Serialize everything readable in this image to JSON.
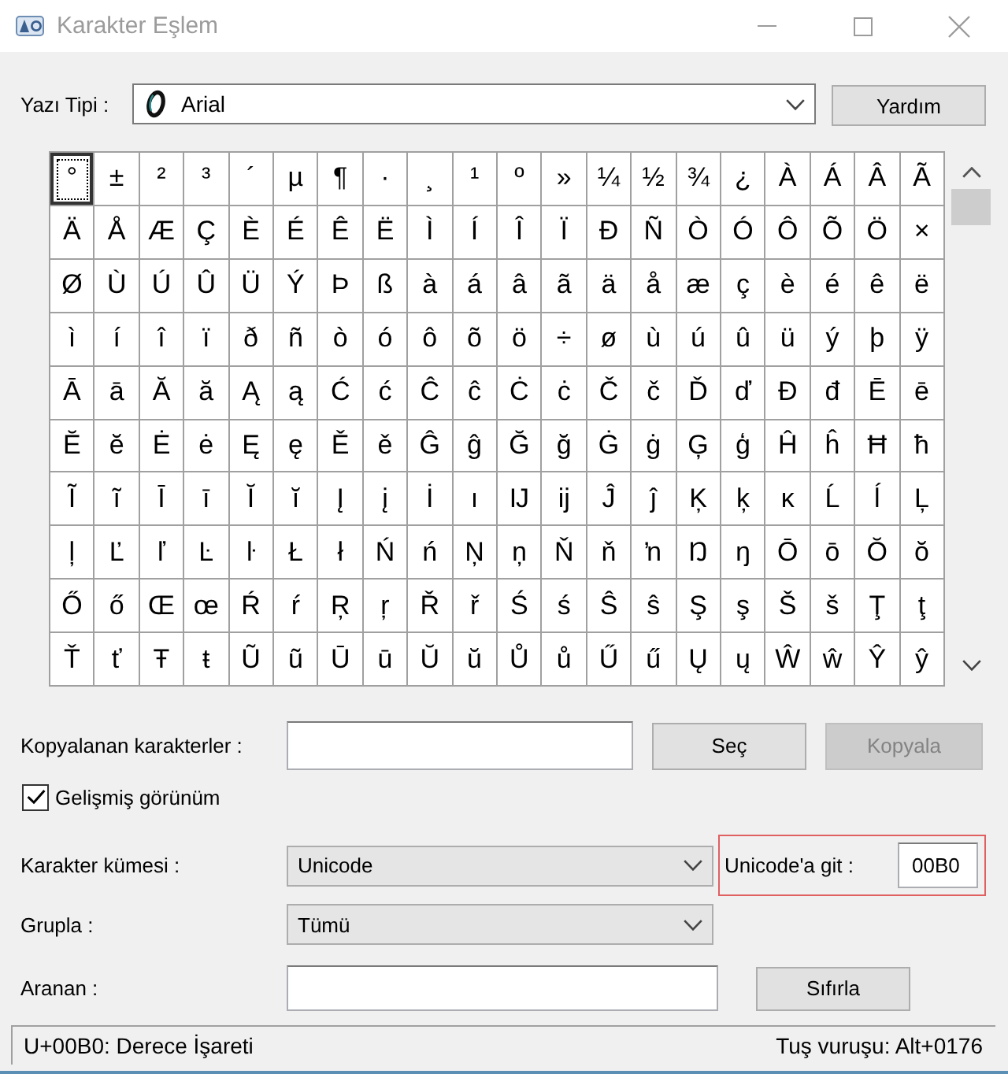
{
  "window": {
    "title": "Karakter Eşlem"
  },
  "font_row": {
    "label": "Yazı Tipi :",
    "font": "Arial",
    "help_button": "Yardım"
  },
  "character_grid": {
    "rows": [
      [
        {
          "char": "°",
          "selected": true
        },
        {
          "char": "±",
          "selected": false
        },
        {
          "char": "²",
          "selected": false
        },
        {
          "char": "³",
          "selected": false
        },
        {
          "char": "´",
          "selected": false
        },
        {
          "char": "µ",
          "selected": false
        },
        {
          "char": "¶",
          "selected": false
        },
        {
          "char": "·",
          "selected": false
        },
        {
          "char": "¸",
          "selected": false
        },
        {
          "char": "¹",
          "selected": false
        },
        {
          "char": "º",
          "selected": false
        },
        {
          "char": "»",
          "selected": false
        },
        {
          "char": "¼",
          "selected": false
        },
        {
          "char": "½",
          "selected": false
        },
        {
          "char": "¾",
          "selected": false
        },
        {
          "char": "¿",
          "selected": false
        },
        {
          "char": "À",
          "selected": false
        },
        {
          "char": "Á",
          "selected": false
        },
        {
          "char": "Â",
          "selected": false
        },
        {
          "char": "Ã",
          "selected": false
        }
      ],
      [
        {
          "char": "Ä",
          "selected": false
        },
        {
          "char": "Å",
          "selected": false
        },
        {
          "char": "Æ",
          "selected": false
        },
        {
          "char": "Ç",
          "selected": false
        },
        {
          "char": "È",
          "selected": false
        },
        {
          "char": "É",
          "selected": false
        },
        {
          "char": "Ê",
          "selected": false
        },
        {
          "char": "Ë",
          "selected": false
        },
        {
          "char": "Ì",
          "selected": false
        },
        {
          "char": "Í",
          "selected": false
        },
        {
          "char": "Î",
          "selected": false
        },
        {
          "char": "Ï",
          "selected": false
        },
        {
          "char": "Ð",
          "selected": false
        },
        {
          "char": "Ñ",
          "selected": false
        },
        {
          "char": "Ò",
          "selected": false
        },
        {
          "char": "Ó",
          "selected": false
        },
        {
          "char": "Ô",
          "selected": false
        },
        {
          "char": "Õ",
          "selected": false
        },
        {
          "char": "Ö",
          "selected": false
        },
        {
          "char": "×",
          "selected": false
        }
      ],
      [
        {
          "char": "Ø",
          "selected": false
        },
        {
          "char": "Ù",
          "selected": false
        },
        {
          "char": "Ú",
          "selected": false
        },
        {
          "char": "Û",
          "selected": false
        },
        {
          "char": "Ü",
          "selected": false
        },
        {
          "char": "Ý",
          "selected": false
        },
        {
          "char": "Þ",
          "selected": false
        },
        {
          "char": "ß",
          "selected": false
        },
        {
          "char": "à",
          "selected": false
        },
        {
          "char": "á",
          "selected": false
        },
        {
          "char": "â",
          "selected": false
        },
        {
          "char": "ã",
          "selected": false
        },
        {
          "char": "ä",
          "selected": false
        },
        {
          "char": "å",
          "selected": false
        },
        {
          "char": "æ",
          "selected": false
        },
        {
          "char": "ç",
          "selected": false
        },
        {
          "char": "è",
          "selected": false
        },
        {
          "char": "é",
          "selected": false
        },
        {
          "char": "ê",
          "selected": false
        },
        {
          "char": "ë",
          "selected": false
        }
      ],
      [
        {
          "char": "ì",
          "selected": false
        },
        {
          "char": "í",
          "selected": false
        },
        {
          "char": "î",
          "selected": false
        },
        {
          "char": "ï",
          "selected": false
        },
        {
          "char": "ð",
          "selected": false
        },
        {
          "char": "ñ",
          "selected": false
        },
        {
          "char": "ò",
          "selected": false
        },
        {
          "char": "ó",
          "selected": false
        },
        {
          "char": "ô",
          "selected": false
        },
        {
          "char": "õ",
          "selected": false
        },
        {
          "char": "ö",
          "selected": false
        },
        {
          "char": "÷",
          "selected": false
        },
        {
          "char": "ø",
          "selected": false
        },
        {
          "char": "ù",
          "selected": false
        },
        {
          "char": "ú",
          "selected": false
        },
        {
          "char": "û",
          "selected": false
        },
        {
          "char": "ü",
          "selected": false
        },
        {
          "char": "ý",
          "selected": false
        },
        {
          "char": "þ",
          "selected": false
        },
        {
          "char": "ÿ",
          "selected": false
        }
      ],
      [
        {
          "char": "Ā",
          "selected": false
        },
        {
          "char": "ā",
          "selected": false
        },
        {
          "char": "Ă",
          "selected": false
        },
        {
          "char": "ă",
          "selected": false
        },
        {
          "char": "Ą",
          "selected": false
        },
        {
          "char": "ą",
          "selected": false
        },
        {
          "char": "Ć",
          "selected": false
        },
        {
          "char": "ć",
          "selected": false
        },
        {
          "char": "Ĉ",
          "selected": false
        },
        {
          "char": "ĉ",
          "selected": false
        },
        {
          "char": "Ċ",
          "selected": false
        },
        {
          "char": "ċ",
          "selected": false
        },
        {
          "char": "Č",
          "selected": false
        },
        {
          "char": "č",
          "selected": false
        },
        {
          "char": "Ď",
          "selected": false
        },
        {
          "char": "ď",
          "selected": false
        },
        {
          "char": "Đ",
          "selected": false
        },
        {
          "char": "đ",
          "selected": false
        },
        {
          "char": "Ē",
          "selected": false
        },
        {
          "char": "ē",
          "selected": false
        }
      ],
      [
        {
          "char": "Ĕ",
          "selected": false
        },
        {
          "char": "ĕ",
          "selected": false
        },
        {
          "char": "Ė",
          "selected": false
        },
        {
          "char": "ė",
          "selected": false
        },
        {
          "char": "Ę",
          "selected": false
        },
        {
          "char": "ę",
          "selected": false
        },
        {
          "char": "Ě",
          "selected": false
        },
        {
          "char": "ě",
          "selected": false
        },
        {
          "char": "Ĝ",
          "selected": false
        },
        {
          "char": "ĝ",
          "selected": false
        },
        {
          "char": "Ğ",
          "selected": false
        },
        {
          "char": "ğ",
          "selected": false
        },
        {
          "char": "Ġ",
          "selected": false
        },
        {
          "char": "ġ",
          "selected": false
        },
        {
          "char": "Ģ",
          "selected": false
        },
        {
          "char": "ģ",
          "selected": false
        },
        {
          "char": "Ĥ",
          "selected": false
        },
        {
          "char": "ĥ",
          "selected": false
        },
        {
          "char": "Ħ",
          "selected": false
        },
        {
          "char": "ħ",
          "selected": false
        }
      ],
      [
        {
          "char": "Ĩ",
          "selected": false
        },
        {
          "char": "ĩ",
          "selected": false
        },
        {
          "char": "Ī",
          "selected": false
        },
        {
          "char": "ī",
          "selected": false
        },
        {
          "char": "Ĭ",
          "selected": false
        },
        {
          "char": "ĭ",
          "selected": false
        },
        {
          "char": "Į",
          "selected": false
        },
        {
          "char": "į",
          "selected": false
        },
        {
          "char": "İ",
          "selected": false
        },
        {
          "char": "ı",
          "selected": false
        },
        {
          "char": "Ĳ",
          "selected": false
        },
        {
          "char": "ĳ",
          "selected": false
        },
        {
          "char": "Ĵ",
          "selected": false
        },
        {
          "char": "ĵ",
          "selected": false
        },
        {
          "char": "Ķ",
          "selected": false
        },
        {
          "char": "ķ",
          "selected": false
        },
        {
          "char": "ĸ",
          "selected": false
        },
        {
          "char": "Ĺ",
          "selected": false
        },
        {
          "char": "ĺ",
          "selected": false
        },
        {
          "char": "Ļ",
          "selected": false
        }
      ],
      [
        {
          "char": "ļ",
          "selected": false
        },
        {
          "char": "Ľ",
          "selected": false
        },
        {
          "char": "ľ",
          "selected": false
        },
        {
          "char": "Ŀ",
          "selected": false
        },
        {
          "char": "ŀ",
          "selected": false
        },
        {
          "char": "Ł",
          "selected": false
        },
        {
          "char": "ł",
          "selected": false
        },
        {
          "char": "Ń",
          "selected": false
        },
        {
          "char": "ń",
          "selected": false
        },
        {
          "char": "Ņ",
          "selected": false
        },
        {
          "char": "ņ",
          "selected": false
        },
        {
          "char": "Ň",
          "selected": false
        },
        {
          "char": "ň",
          "selected": false
        },
        {
          "char": "ŉ",
          "selected": false
        },
        {
          "char": "Ŋ",
          "selected": false
        },
        {
          "char": "ŋ",
          "selected": false
        },
        {
          "char": "Ō",
          "selected": false
        },
        {
          "char": "ō",
          "selected": false
        },
        {
          "char": "Ŏ",
          "selected": false
        },
        {
          "char": "ŏ",
          "selected": false
        }
      ],
      [
        {
          "char": "Ő",
          "selected": false
        },
        {
          "char": "ő",
          "selected": false
        },
        {
          "char": "Œ",
          "selected": false
        },
        {
          "char": "œ",
          "selected": false
        },
        {
          "char": "Ŕ",
          "selected": false
        },
        {
          "char": "ŕ",
          "selected": false
        },
        {
          "char": "Ŗ",
          "selected": false
        },
        {
          "char": "ŗ",
          "selected": false
        },
        {
          "char": "Ř",
          "selected": false
        },
        {
          "char": "ř",
          "selected": false
        },
        {
          "char": "Ś",
          "selected": false
        },
        {
          "char": "ś",
          "selected": false
        },
        {
          "char": "Ŝ",
          "selected": false
        },
        {
          "char": "ŝ",
          "selected": false
        },
        {
          "char": "Ş",
          "selected": false
        },
        {
          "char": "ş",
          "selected": false
        },
        {
          "char": "Š",
          "selected": false
        },
        {
          "char": "š",
          "selected": false
        },
        {
          "char": "Ţ",
          "selected": false
        },
        {
          "char": "ţ",
          "selected": false
        }
      ],
      [
        {
          "char": "Ť",
          "selected": false
        },
        {
          "char": "ť",
          "selected": false
        },
        {
          "char": "Ŧ",
          "selected": false
        },
        {
          "char": "ŧ",
          "selected": false
        },
        {
          "char": "Ũ",
          "selected": false
        },
        {
          "char": "ũ",
          "selected": false
        },
        {
          "char": "Ū",
          "selected": false
        },
        {
          "char": "ū",
          "selected": false
        },
        {
          "char": "Ŭ",
          "selected": false
        },
        {
          "char": "ŭ",
          "selected": false
        },
        {
          "char": "Ů",
          "selected": false
        },
        {
          "char": "ů",
          "selected": false
        },
        {
          "char": "Ű",
          "selected": false
        },
        {
          "char": "ű",
          "selected": false
        },
        {
          "char": "Ų",
          "selected": false
        },
        {
          "char": "ų",
          "selected": false
        },
        {
          "char": "Ŵ",
          "selected": false
        },
        {
          "char": "ŵ",
          "selected": false
        },
        {
          "char": "Ŷ",
          "selected": false
        },
        {
          "char": "ŷ",
          "selected": false
        }
      ]
    ]
  },
  "copy_row": {
    "label": "Kopyalanan karakterler :",
    "select_button": {
      "label": "Seç",
      "disabled": false
    },
    "copy_button": {
      "label": "Kopyala",
      "disabled": true
    }
  },
  "advanced_view": {
    "label": "Gelişmiş görünüm",
    "checked": true
  },
  "character_set": {
    "label": "Karakter kümesi :",
    "value": "Unicode"
  },
  "go_to_unicode": {
    "label": "Unicode'a git :",
    "value": "00B0",
    "highlighted": true
  },
  "group_by": {
    "label": "Grupla :",
    "value": "Tümü"
  },
  "search": {
    "label": "Aranan :",
    "reset_button": "Sıfırla"
  },
  "status_bar": {
    "description": "U+00B0: Derece İşareti",
    "keystroke": "Tuş vuruşu: Alt+0176"
  }
}
